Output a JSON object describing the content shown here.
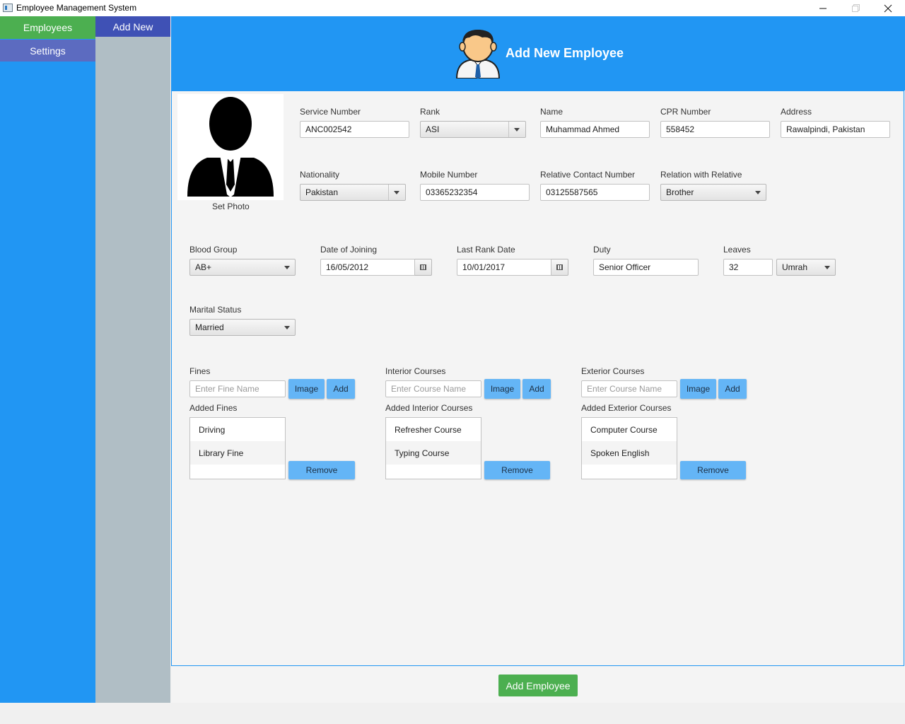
{
  "window": {
    "title": "Employee Management System",
    "minimize": "─",
    "maximize": "❐",
    "close": "✕"
  },
  "nav": {
    "employees": "Employees",
    "settings": "Settings"
  },
  "subnav": {
    "add_new": "Add New"
  },
  "header": {
    "title": "Add New Employee"
  },
  "photo": {
    "label": "Set Photo"
  },
  "form": {
    "service_number": {
      "label": "Service Number",
      "value": "ANC002542"
    },
    "rank": {
      "label": "Rank",
      "value": "ASI"
    },
    "name": {
      "label": "Name",
      "value": "Muhammad Ahmed"
    },
    "cpr_number": {
      "label": "CPR Number",
      "value": "558452"
    },
    "address": {
      "label": "Address",
      "value": "Rawalpindi, Pakistan"
    },
    "nationality": {
      "label": "Nationality",
      "value": "Pakistan"
    },
    "mobile_number": {
      "label": "Mobile Number",
      "value": "03365232354"
    },
    "relative_contact": {
      "label": "Relative Contact Number",
      "value": "03125587565"
    },
    "relation": {
      "label": "Relation with Relative",
      "value": "Brother"
    },
    "blood_group": {
      "label": "Blood Group",
      "value": "AB+"
    },
    "date_of_joining": {
      "label": "Date of Joining",
      "value": "16/05/2012"
    },
    "last_rank_date": {
      "label": "Last Rank Date",
      "value": "10/01/2017"
    },
    "duty": {
      "label": "Duty",
      "value": "Senior Officer"
    },
    "leaves": {
      "label": "Leaves",
      "value": "32",
      "type": "Umrah"
    },
    "marital_status": {
      "label": "Marital Status",
      "value": "Married"
    }
  },
  "fines": {
    "label": "Fines",
    "placeholder": "Enter Fine Name",
    "image_btn": "Image",
    "add_btn": "Add",
    "list_label": "Added Fines",
    "items": [
      "Driving",
      "Library Fine"
    ],
    "remove_btn": "Remove"
  },
  "interior": {
    "label": "Interior Courses",
    "placeholder": "Enter Course Name",
    "image_btn": "Image",
    "add_btn": "Add",
    "list_label": "Added Interior Courses",
    "items": [
      "Refresher Course",
      "Typing Course"
    ],
    "remove_btn": "Remove"
  },
  "exterior": {
    "label": "Exterior Courses",
    "placeholder": "Enter Course Name",
    "image_btn": "Image",
    "add_btn": "Add",
    "list_label": "Added Exterior Courses",
    "items": [
      "Computer Course",
      "Spoken English"
    ],
    "remove_btn": "Remove"
  },
  "actions": {
    "add_employee": "Add Employee"
  },
  "colors": {
    "nav_blue": "#2196f3",
    "green": "#4caf50",
    "indigo": "#3f51b5",
    "settings": "#5c6bc0",
    "subnav": "#b0bec5",
    "button_blue": "#64b5f6"
  }
}
